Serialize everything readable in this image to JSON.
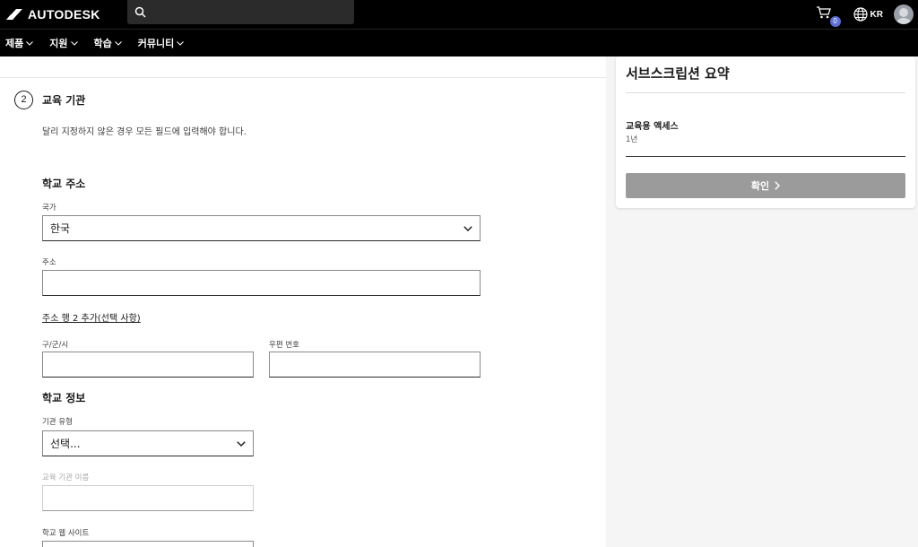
{
  "header": {
    "brand": "AUTODESK",
    "search_placeholder": "",
    "cart_count": "0",
    "language": "KR"
  },
  "nav": {
    "items": [
      {
        "label": "제품"
      },
      {
        "label": "지원"
      },
      {
        "label": "학습"
      },
      {
        "label": "커뮤니티"
      }
    ]
  },
  "form": {
    "step_number": "2",
    "step_title": "교육 기관",
    "note": "달리 지정하지 않은 경우 모든 필드에 입력해야 합니다.",
    "address_section": {
      "title": "학교 주소",
      "country_label": "국가",
      "country_value": "한국",
      "address_label": "주소",
      "address_value": "",
      "add_line_link": "주소 행 2 추가(선택 사항)",
      "city_label": "구/군/시",
      "city_value": "",
      "postal_label": "우편 번호",
      "postal_value": ""
    },
    "school_section": {
      "title": "학교 정보",
      "type_label": "기관 유형",
      "type_value": "선택...",
      "name_label": "교육 기관 이름",
      "name_value": "",
      "website_label": "학교 웹 사이트"
    }
  },
  "summary": {
    "title": "서브스크립션 요약",
    "item_name": "교육용 액세스",
    "item_term": "1년",
    "confirm_label": "확인"
  },
  "colors": {
    "topbar": "#000000",
    "cart_badge": "#5b6fd6",
    "confirm_button": "#9b9b9b"
  }
}
